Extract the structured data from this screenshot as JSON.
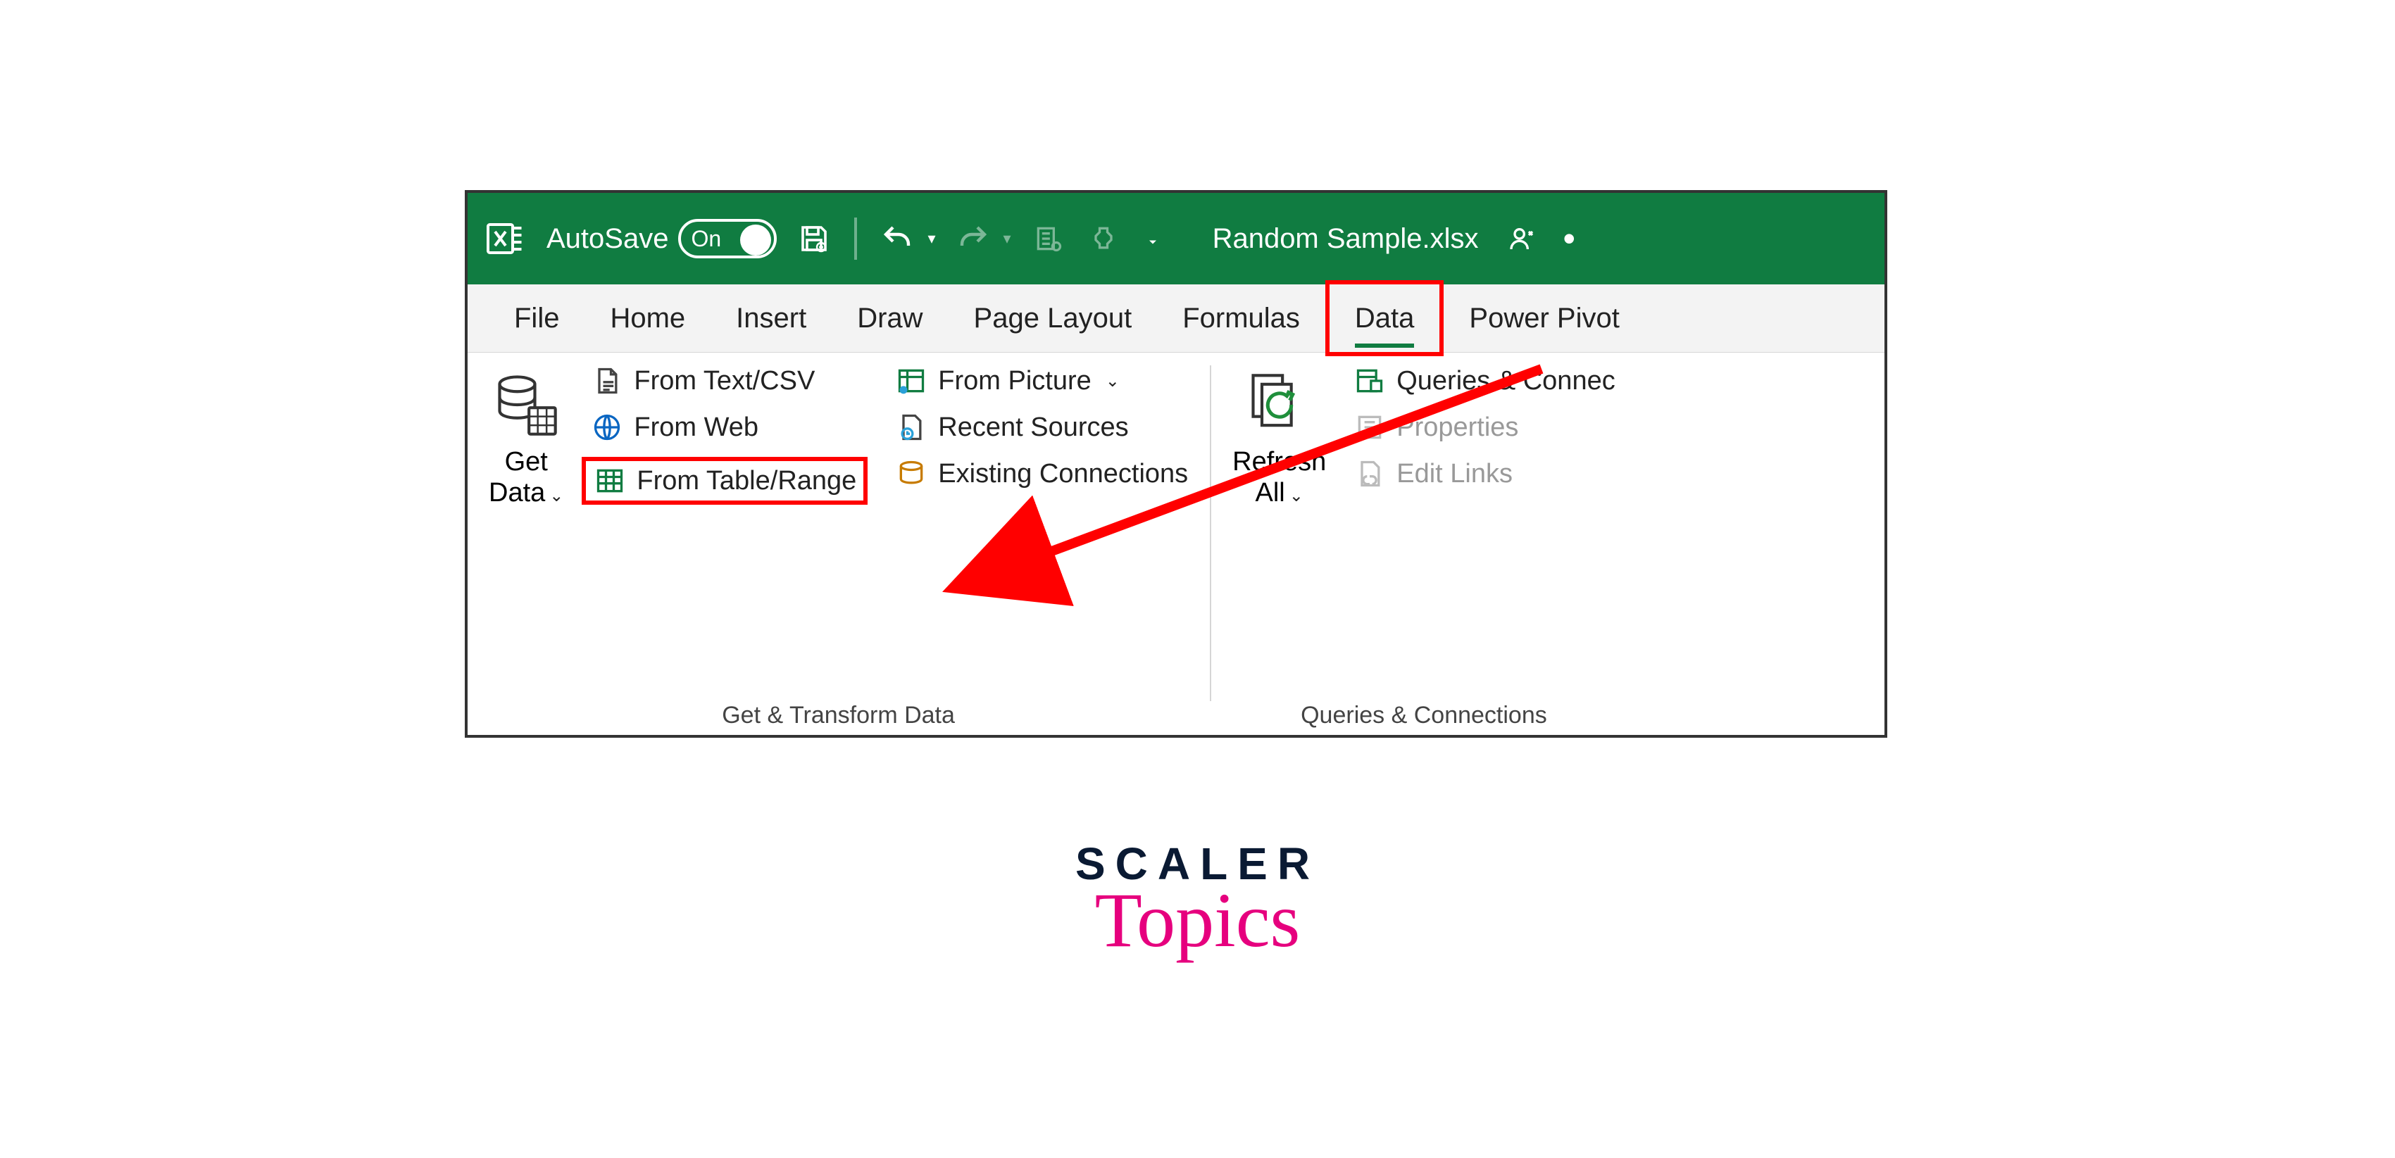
{
  "titlebar": {
    "autosave_label": "AutoSave",
    "autosave_state": "On",
    "filename": "Random Sample.xlsx"
  },
  "tabs": {
    "items": [
      "File",
      "Home",
      "Insert",
      "Draw",
      "Page Layout",
      "Formulas",
      "Data",
      "Power Pivot"
    ],
    "active_index": 6
  },
  "ribbon": {
    "get_transform": {
      "get_data": "Get\nData",
      "from_text_csv": "From Text/CSV",
      "from_web": "From Web",
      "from_table_range": "From Table/Range",
      "from_picture": "From Picture",
      "recent_sources": "Recent Sources",
      "existing_connections": "Existing Connections",
      "caption": "Get & Transform Data"
    },
    "queries": {
      "refresh_all": "Refresh\nAll",
      "queries_connections": "Queries & Connec",
      "properties": "Properties",
      "edit_links": "Edit Links",
      "caption": "Queries & Connections"
    }
  },
  "watermark": {
    "line1": "SCALER",
    "line2": "Topics"
  },
  "colors": {
    "excel_green": "#107c41",
    "highlight_red": "#ff0000",
    "brand_pink": "#e6007e"
  }
}
